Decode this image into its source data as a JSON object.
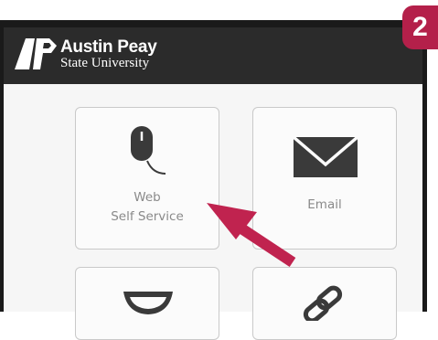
{
  "header": {
    "logo_line1": "Austin Peay",
    "logo_line2": "State University"
  },
  "tiles": [
    {
      "label_line1": "Web",
      "label_line2": "Self Service",
      "icon": "mouse-icon"
    },
    {
      "label_line1": "Email",
      "label_line2": "",
      "icon": "envelope-icon"
    },
    {
      "icon": "bowl-icon"
    },
    {
      "icon": "link-icon"
    }
  ],
  "step_badge": "2",
  "colors": {
    "header_bg": "#2b2b2b",
    "badge": "#b4204a",
    "arrow": "#c0234f",
    "icon": "#3a3a3a"
  }
}
